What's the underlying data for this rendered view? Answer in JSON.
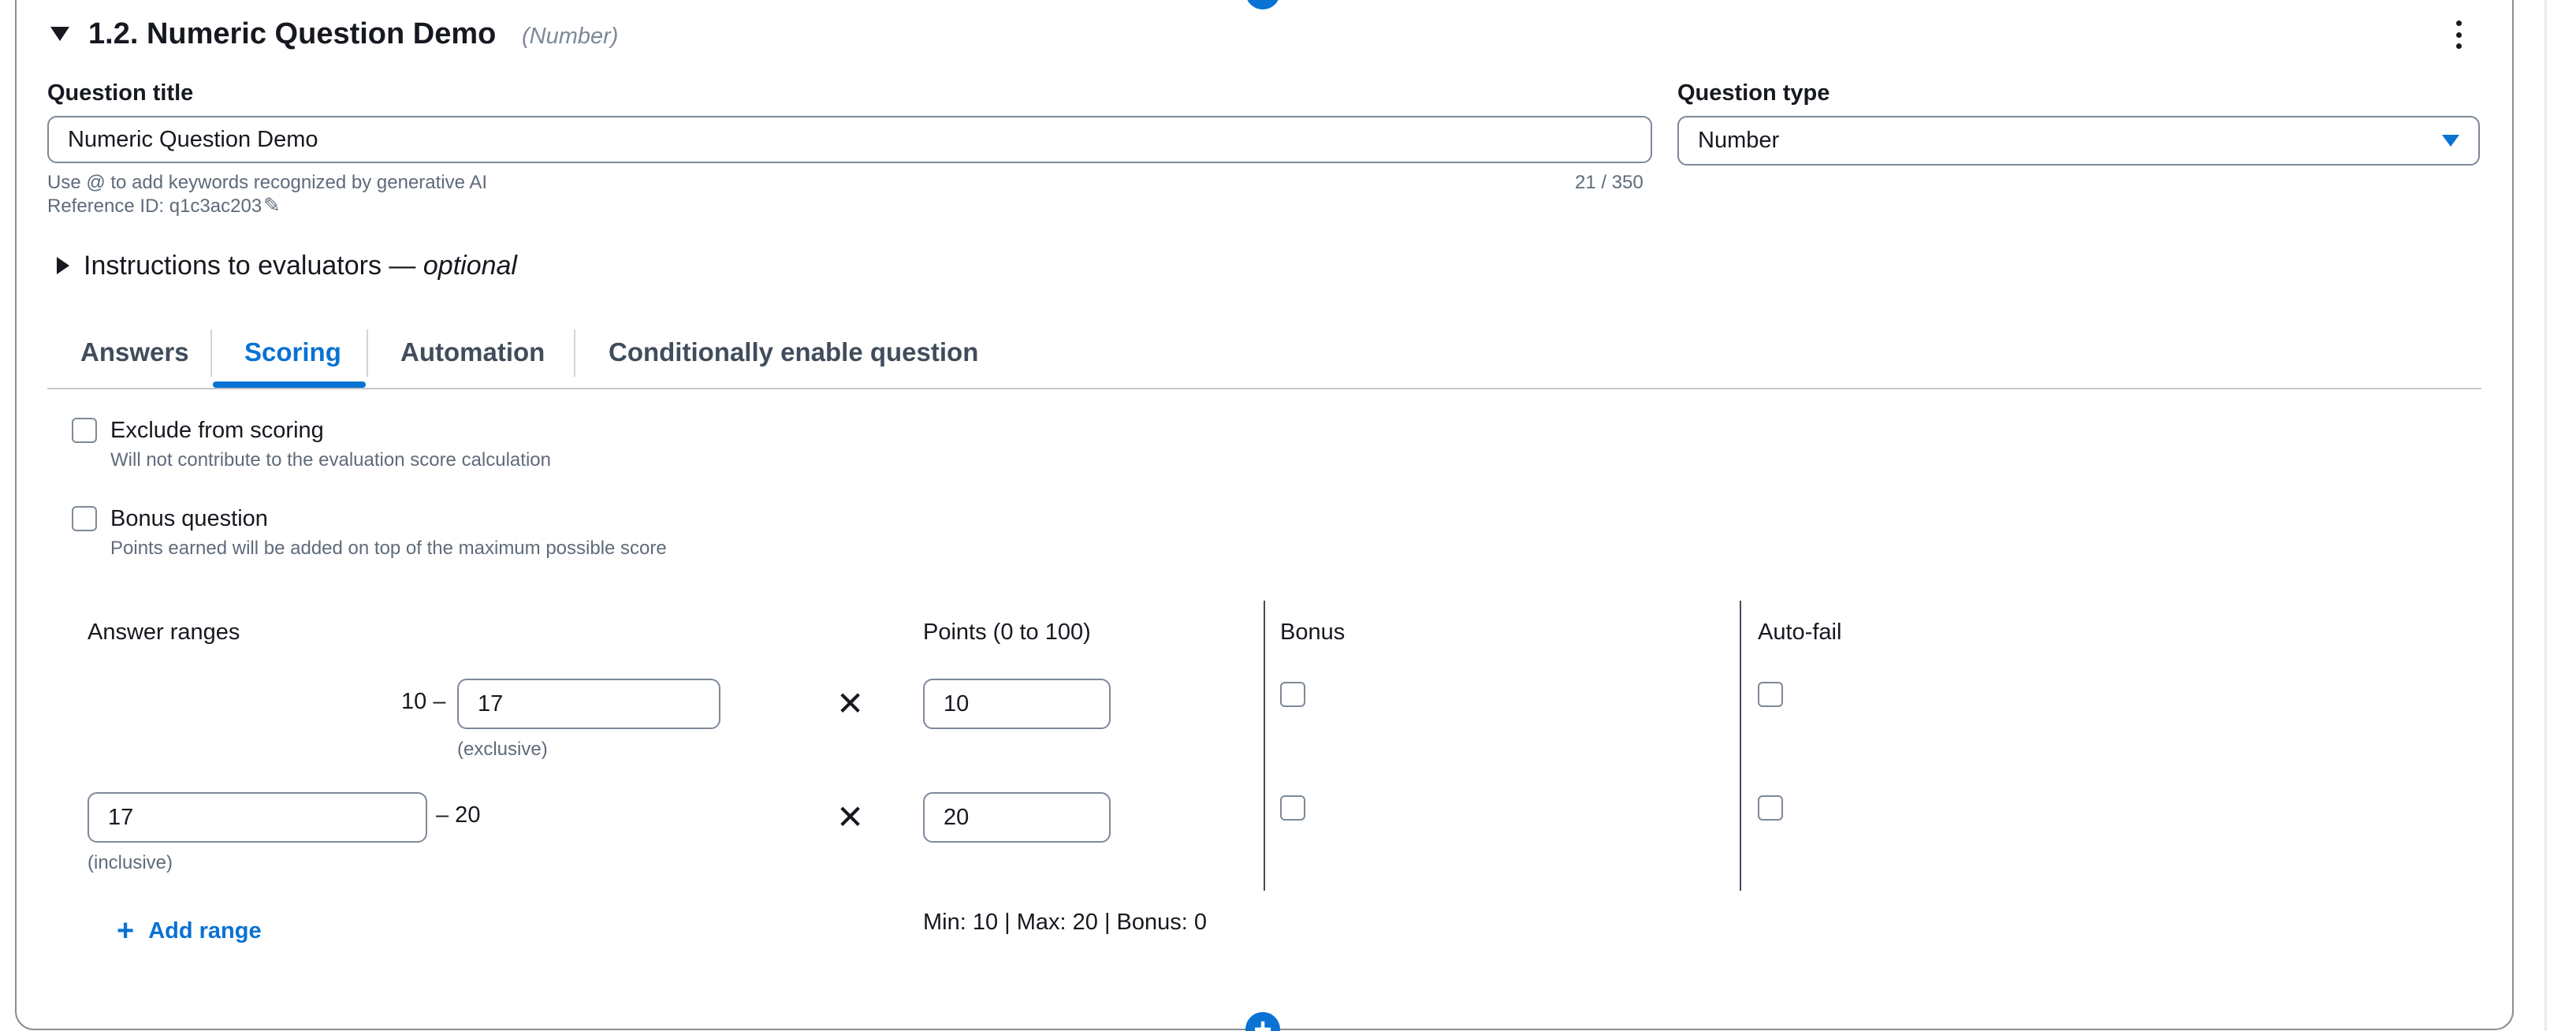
{
  "question": {
    "header_title": "1.2. Numeric Question Demo",
    "header_type": "(Number)",
    "title_label": "Question title",
    "title_value": "Numeric Question Demo",
    "title_hint": "Use @ to add keywords recognized by generative AI",
    "title_counter": "21 / 350",
    "reference_id": "Reference ID: q1c3ac203",
    "type_label": "Question type",
    "type_value": "Number",
    "instructions_label": "Instructions to evaluators — ",
    "instructions_optional": "optional"
  },
  "tabs": [
    {
      "label": "Answers",
      "active": false
    },
    {
      "label": "Scoring",
      "active": true
    },
    {
      "label": "Automation",
      "active": false
    },
    {
      "label": "Conditionally enable question",
      "active": false
    }
  ],
  "scoring": {
    "exclude_label": "Exclude from scoring",
    "exclude_desc": "Will not contribute to the evaluation score calculation",
    "exclude_checked": false,
    "bonus_label": "Bonus question",
    "bonus_desc": "Points earned will be added on top of the maximum possible score",
    "bonus_checked": false,
    "col_ranges": "Answer ranges",
    "col_points": "Points (0 to 100)",
    "col_bonus": "Bonus",
    "col_autofail": "Auto-fail",
    "ranges": [
      {
        "prefix": "10 –",
        "input_value": "17",
        "note": "(exclusive)",
        "points": "10",
        "bonus": false,
        "autofail": false
      },
      {
        "input_value": "17",
        "suffix": "– 20",
        "note": "(inclusive)",
        "points": "20",
        "bonus": false,
        "autofail": false
      }
    ],
    "add_range_label": "Add range",
    "summary": "Min: 10 | Max: 20 | Bonus: 0"
  },
  "icons": {
    "collapse": "caret-down-icon",
    "more": "kebab-menu-icon",
    "edit": "pencil-icon",
    "expand": "caret-right-icon",
    "remove": "close-icon",
    "add": "plus-icon",
    "select": "dropdown-caret-icon"
  },
  "colors": {
    "accent": "#0972d3",
    "border": "#7d8998",
    "text": "#16191f",
    "muted": "#5f6b7a"
  }
}
